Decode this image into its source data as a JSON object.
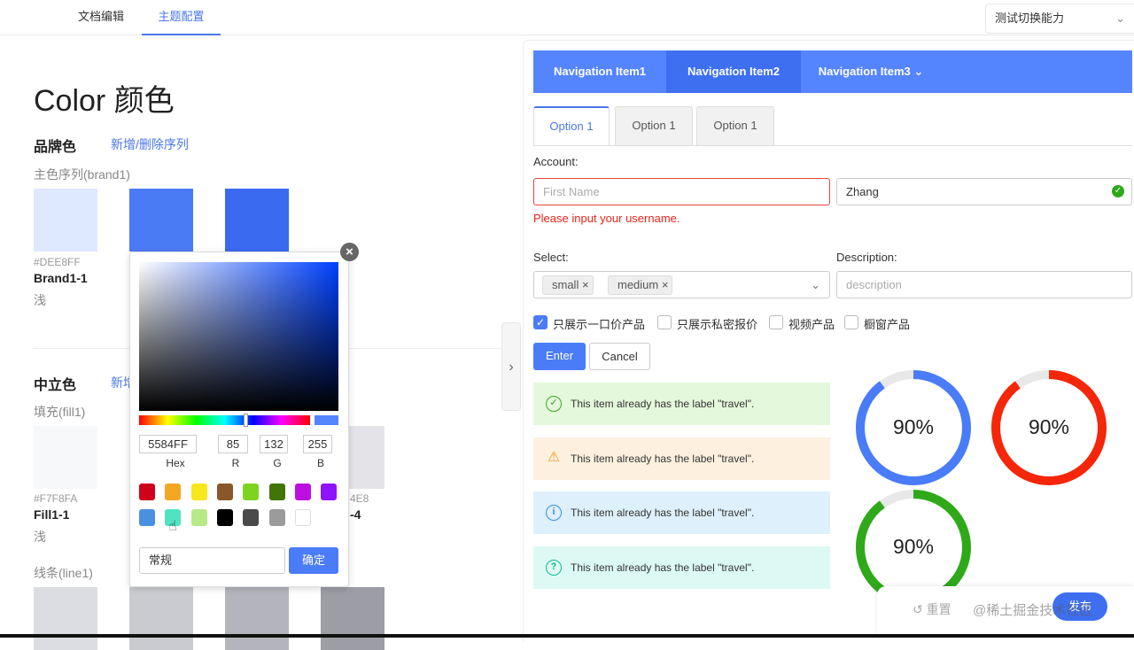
{
  "topbar": {
    "tabs": [
      {
        "label": "文档编辑"
      },
      {
        "label": "主题配置"
      }
    ],
    "select": "测试切换能力"
  },
  "left": {
    "title": "Color 颜色",
    "brand": {
      "heading": "品牌色",
      "action": "新增/删除序列",
      "series_label": "主色序列(brand1)",
      "swatches": [
        {
          "color": "#DEE8FF",
          "hex": "#DEE8FF",
          "name": "Brand1-1",
          "tone": "浅"
        },
        {
          "color": "#4B7AF5"
        },
        {
          "color": "#3A6AF0"
        }
      ]
    },
    "neutral": {
      "heading": "中立色",
      "action": "新增/删除序列",
      "fill_label": "填充(fill1)",
      "fill_swatches": [
        {
          "color": "#F7F8FA",
          "hex": "#F7F8FA",
          "name": "Fill1-1",
          "tone": "浅"
        },
        {
          "color": "#E4E4E8",
          "hex_partial": "4E8",
          "name_partial": "-4"
        }
      ],
      "line_label": "线条(line1)",
      "line_colors": [
        "#DCDDE2",
        "#CACBD0",
        "#B4B5BC",
        "#9C9DA5"
      ]
    }
  },
  "picker": {
    "hex": "5584FF",
    "r": "85",
    "g": "132",
    "b": "255",
    "labels": {
      "hex": "Hex",
      "r": "R",
      "g": "G",
      "b": "B"
    },
    "presets": [
      "#D0021B",
      "#F5A623",
      "#F8E71C",
      "#8B572A",
      "#7ED321",
      "#417505",
      "#BD10E0",
      "#9013FE",
      "#4A90E2",
      "#50E3C2",
      "#B8E986",
      "#000000",
      "#4A4A4A",
      "#9B9B9B",
      "#FFFFFF"
    ],
    "name_value": "常规",
    "confirm": "确定"
  },
  "right": {
    "nav": [
      {
        "label": "Navigation Item1"
      },
      {
        "label": "Navigation Item2"
      },
      {
        "label": "Navigation Item3"
      }
    ],
    "tabs": [
      {
        "label": "Option 1"
      },
      {
        "label": "Option 1"
      },
      {
        "label": "Option 1"
      }
    ],
    "account_label": "Account:",
    "first_name_placeholder": "First Name",
    "last_name_value": "Zhang",
    "error": "Please input your username.",
    "select_label": "Select:",
    "tags": [
      "small",
      "medium"
    ],
    "description_label": "Description:",
    "description_placeholder": "description",
    "checkboxes": [
      {
        "label": "只展示一口价产品",
        "checked": true
      },
      {
        "label": "只展示私密报价",
        "checked": false
      },
      {
        "label": "视频产品",
        "checked": false
      },
      {
        "label": "橱窗产品",
        "checked": false
      }
    ],
    "enter": "Enter",
    "cancel": "Cancel",
    "alerts": [
      {
        "type": "success",
        "text": "This item already has the label \"travel\"."
      },
      {
        "type": "warning",
        "text": "This item already has the label \"travel\"."
      },
      {
        "type": "info",
        "text": "This item already has the label \"travel\"."
      },
      {
        "type": "help",
        "text": "This item already has the label \"travel\"."
      }
    ],
    "progress": [
      {
        "value": 90,
        "label": "90%",
        "color": "#4a7cf7"
      },
      {
        "value": 90,
        "label": "90%",
        "color": "#f5260a"
      },
      {
        "value": 90,
        "label": "90%",
        "color": "#2fa91a"
      }
    ]
  },
  "bottom": {
    "reset": "重置",
    "publish": "发布",
    "watermark": "@稀土掘金技术社区"
  }
}
